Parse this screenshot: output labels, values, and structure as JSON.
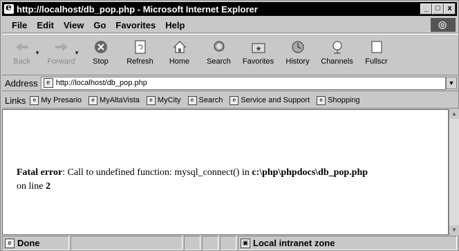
{
  "window": {
    "title": "http://localhost/db_pop.php - Microsoft Internet Explorer",
    "controls": [
      "_",
      "□",
      "x"
    ]
  },
  "menu": [
    "File",
    "Edit",
    "View",
    "Go",
    "Favorites",
    "Help"
  ],
  "toolbar": [
    {
      "label": "Back",
      "icon": "back-arrow-icon",
      "disabled": true,
      "dropdown": true
    },
    {
      "label": "Forward",
      "icon": "forward-arrow-icon",
      "disabled": true,
      "dropdown": true
    },
    {
      "label": "Stop",
      "icon": "stop-icon",
      "disabled": false
    },
    {
      "label": "Refresh",
      "icon": "refresh-icon",
      "disabled": false
    },
    {
      "label": "Home",
      "icon": "home-icon",
      "disabled": false
    },
    {
      "label": "Search",
      "icon": "search-icon",
      "disabled": false
    },
    {
      "label": "Favorites",
      "icon": "favorites-icon",
      "disabled": false
    },
    {
      "label": "History",
      "icon": "history-icon",
      "disabled": false
    },
    {
      "label": "Channels",
      "icon": "channels-icon",
      "disabled": false
    },
    {
      "label": "Fullscr",
      "icon": "fullscreen-icon",
      "disabled": false
    }
  ],
  "address": {
    "label": "Address",
    "value": "http://localhost/db_pop.php"
  },
  "links": {
    "label": "Links",
    "items": [
      "My Presario",
      "MyAltaVista",
      "MyCity",
      "Search",
      "Service and Support",
      "Shopping"
    ]
  },
  "content": {
    "error_label": "Fatal error",
    "error_text": ": Call to undefined function: mysql_connect() in ",
    "error_path": "c:\\php\\phpdocs\\db_pop.php",
    "line_text": "on line ",
    "line_number": "2"
  },
  "status": {
    "text": "Done",
    "zone": "Local intranet zone"
  }
}
